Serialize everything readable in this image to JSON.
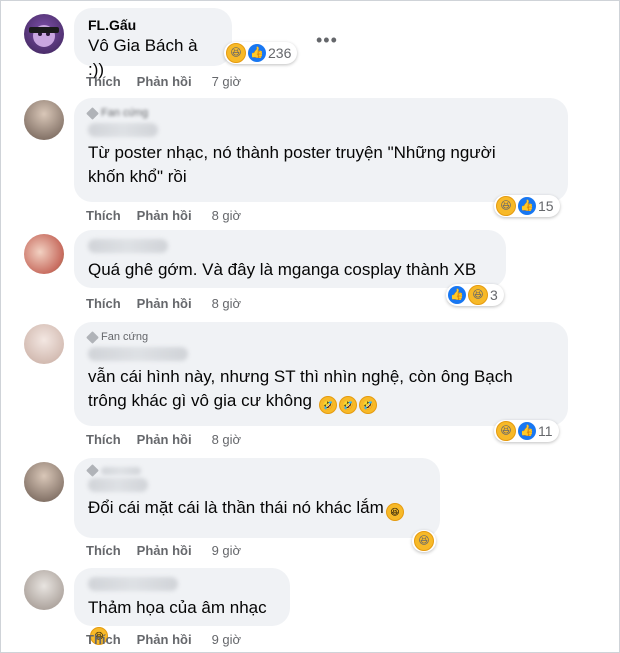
{
  "comments": [
    {
      "name": "FL.Gấu",
      "text": "Vô Gia Bách à :))",
      "time": "7 giờ",
      "react_count": "236"
    },
    {
      "badge": "Fan cứng",
      "text_l1": "Từ poster nhạc, nó thành poster truyện \"Những người",
      "text_l2": "khốn khổ\" rồi",
      "time": "8 giờ",
      "react_count": "15"
    },
    {
      "text": "Quá ghê gớm. Và đây là mganga cosplay thành XB",
      "time": "8 giờ",
      "react_count": "3"
    },
    {
      "badge": "Fan cứng",
      "text_l1": "vẫn cái hình này, nhưng ST thì nhìn nghệ, còn ông Bạch",
      "text_l2": "trông khác gì vô gia cư không",
      "time": "8 giờ",
      "react_count": "11"
    },
    {
      "text": "Đổi cái mặt cái là thần thái nó khác lắm",
      "time": "9 giờ"
    },
    {
      "text": "Thảm họa của âm nhạc",
      "time": "9 giờ"
    }
  ],
  "labels": {
    "like": "Thích",
    "reply": "Phản hồi",
    "more": "•••"
  },
  "icons": {
    "haha": "haha-emoji-icon",
    "like": "like-thumb-icon",
    "rofl": "rofl-emoji-icon"
  },
  "colors": {
    "bubble": "#f0f2f5",
    "like_blue": "#1877f2",
    "haha_yellow": "#f7b928",
    "meta_gray": "#65676b"
  }
}
